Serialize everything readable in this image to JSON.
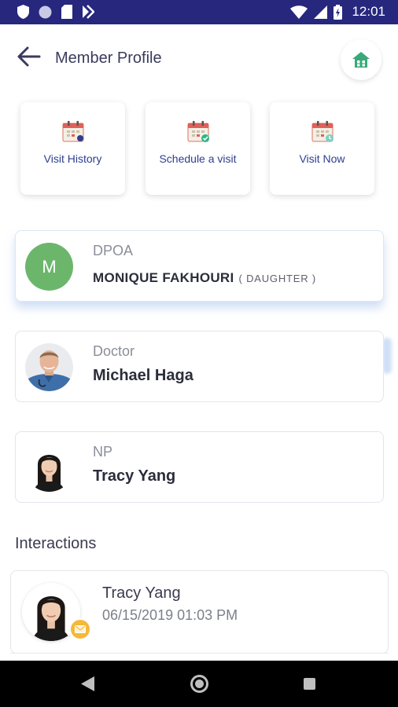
{
  "status_bar": {
    "time": "12:01",
    "left_icons": [
      "shield-icon",
      "circle-icon",
      "sd-card-icon",
      "download-icon"
    ],
    "right_icons": [
      "wifi-icon",
      "signal-icon",
      "battery-icon"
    ]
  },
  "header": {
    "title": "Member Profile",
    "back_icon": "arrow-left-icon",
    "home_icon": "house-icon"
  },
  "actions": [
    {
      "label": "Visit History",
      "icon": "calendar-history-icon"
    },
    {
      "label": "Schedule a visit",
      "icon": "calendar-check-icon"
    },
    {
      "label": "Visit Now",
      "icon": "calendar-clock-icon"
    }
  ],
  "contacts": {
    "dpoa": {
      "role": "DPOA",
      "name": "MONIQUE FAKHOURI",
      "relation": "( DAUGHTER )",
      "initial": "M"
    },
    "doctor": {
      "role": "Doctor",
      "name": "Michael Haga"
    },
    "np": {
      "role": "NP",
      "name": "Tracy Yang"
    }
  },
  "interactions": {
    "title": "Interactions",
    "items": [
      {
        "name": "Tracy Yang",
        "date": "06/15/2019 01:03 PM",
        "badge": "mail-icon"
      }
    ]
  },
  "colors": {
    "status_bar": "#26277d",
    "accent_blue": "#2c3e8f",
    "avatar_green": "#6cb66c",
    "badge_yellow": "#f4b83a",
    "home_green": "#3aa878"
  }
}
